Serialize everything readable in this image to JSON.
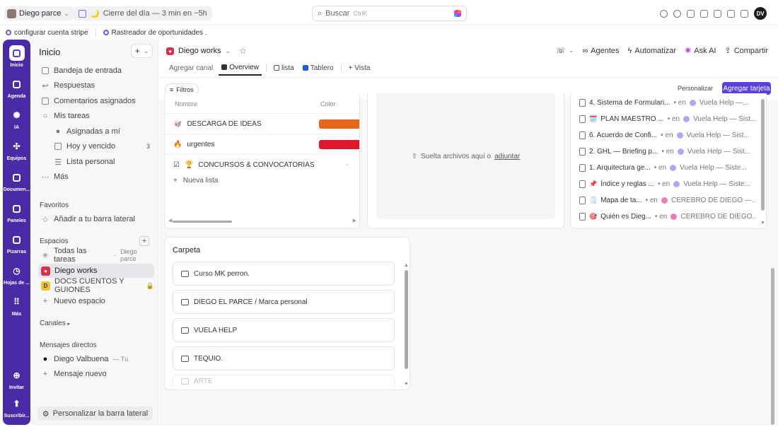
{
  "topbar": {
    "workspace": "Diego parce",
    "reminder": "Cierre del día — 3 min en ~5h",
    "search_placeholder": "Buscar",
    "search_shortcut": "CtrlK",
    "user_initials": "DV"
  },
  "shortcuts": [
    "configurar cuenta stripe",
    "Rastreador de oportunidades ."
  ],
  "rail": [
    {
      "label": "Inicio",
      "icon": "home-icon"
    },
    {
      "label": "Agenda",
      "icon": "calendar-icon"
    },
    {
      "label": "IA",
      "icon": "ai-icon"
    },
    {
      "label": "Equipos",
      "icon": "teams-icon"
    },
    {
      "label": "Documen...",
      "icon": "docs-icon"
    },
    {
      "label": "Paneles",
      "icon": "dashboards-icon"
    },
    {
      "label": "Pizarras",
      "icon": "whiteboards-icon"
    },
    {
      "label": "Hojas de ...",
      "icon": "timesheets-icon"
    },
    {
      "label": "Más",
      "icon": "grid-icon"
    },
    {
      "label": "Invitar",
      "icon": "invite-icon"
    },
    {
      "label": "Suscribir...",
      "icon": "upgrade-icon"
    }
  ],
  "sidebar": {
    "title": "Inicio",
    "nav": {
      "inbox": "Bandeja de entrada",
      "replies": "Respuestas",
      "comments": "Comentarios asignados",
      "my_tasks": "Mis tareas",
      "assigned": "Asignadas a mí",
      "today": "Hoy y vencido",
      "today_count": "3",
      "personal_list": "Lista personal",
      "more": "Más"
    },
    "favorites_title": "Favoritos",
    "favorites_add": "Añadir a tu barra lateral",
    "spaces_title": "Espacios",
    "spaces": {
      "all_tasks": "Todas las tareas",
      "all_tasks_owner": "Diego parce",
      "diego_works": "Diego works",
      "docs": "DOCS CUENTOS Y GUIONES",
      "new_space": "Nuevo espacio"
    },
    "channels_title": "Canales",
    "dm_title": "Mensajes directos",
    "dm_user": "Diego Valbuena",
    "dm_you": "— Tú",
    "new_message": "Mensaje nuevo",
    "customize": "Personalizar la barra lateral"
  },
  "main": {
    "space_name": "Diego works",
    "actions": {
      "agents": "Agentes",
      "automate": "Automatizar",
      "ask_ai": "Ask AI",
      "share": "Compartir"
    },
    "tabs": {
      "add_channel": "Agregar canal",
      "overview": "Overview",
      "list": "lista",
      "board": "Tablero",
      "view": "Vista"
    },
    "filters": "Filtros",
    "personalize": "Personalizar",
    "add_card": "Agregar tarjeta"
  },
  "lists_card": {
    "col_name": "Nombre",
    "col_color": "Color",
    "rows": [
      {
        "name": "DESCARGA DE IDEAS",
        "emoji": "🥡",
        "color": "#e8651a"
      },
      {
        "name": "urgentes",
        "emoji": "🔥",
        "color": "#e0162b"
      },
      {
        "name": "CONCURSOS & CONVOCATORIAS",
        "emoji": "🏆",
        "color": ""
      }
    ],
    "dash": "-",
    "new_list": "Nueva lista"
  },
  "drop_card": {
    "text": "Suelta archivos aquí o",
    "link": "adjuntar"
  },
  "docs_card": {
    "rows": [
      {
        "title": "4. Sistema de Formulari...",
        "space": "Vuela Help —...",
        "emoji": ""
      },
      {
        "title": "PLAN MAESTRO ...",
        "space": "Vuela Help — Sist...",
        "emoji": "🗓️"
      },
      {
        "title": "6. Acuerdo de Confi...",
        "space": "Vuela Help — Sist...",
        "emoji": ""
      },
      {
        "title": "2. GHL — Briefing p...",
        "space": "Vuela Help — Sist...",
        "emoji": ""
      },
      {
        "title": "1. Arquitectura ge...",
        "space": "Vuela Help — Siste...",
        "emoji": ""
      },
      {
        "title": "Índice y reglas ...",
        "space": "Vuela Help — Siste...",
        "emoji": "📌"
      },
      {
        "title": "Mapa de ta...",
        "space": "CEREBRO DE DIEGO —...",
        "emoji": "🗒️"
      },
      {
        "title": "Quién es Dieg...",
        "space": "CEREBRO DE DIEGO...",
        "emoji": "🎯"
      }
    ],
    "in_word": "• en"
  },
  "folder_card": {
    "title": "Carpeta",
    "folders": [
      "Curso MK perron.",
      "DIEGO EL PARCE / Marca personal",
      "VUELA HELP",
      "TEQUIO.",
      "ARTE"
    ]
  }
}
